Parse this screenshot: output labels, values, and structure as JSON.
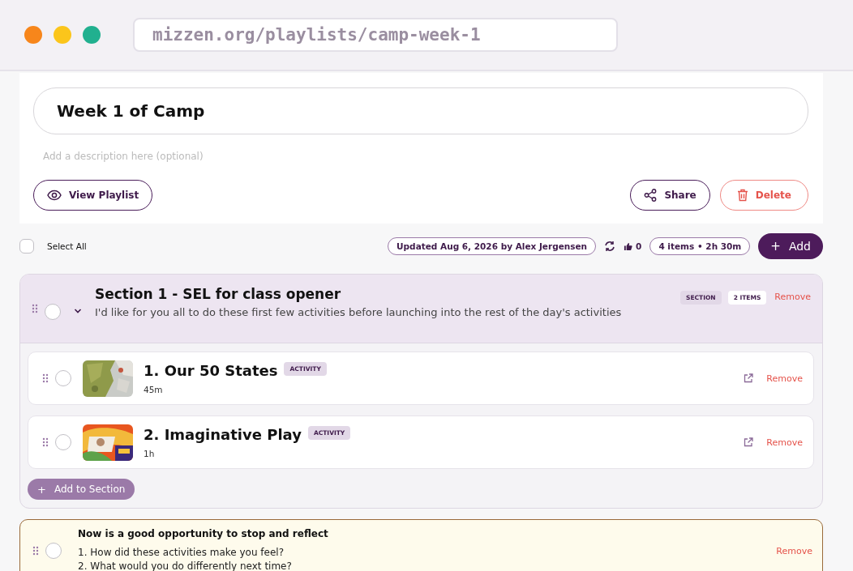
{
  "browser": {
    "url": "mizzen.org/playlists/camp-week-1"
  },
  "playlist": {
    "title": "Week 1 of Camp",
    "description_placeholder": "Add a description here (optional)",
    "view_button": "View Playlist",
    "share_button": "Share",
    "delete_button": "Delete"
  },
  "toolbar": {
    "select_all": {
      "label": "Select All",
      "checked": false
    },
    "updated": "Updated Aug 6, 2026 by Alex Jergensen",
    "likes": "0",
    "summary": "4 items • 2h 30m",
    "add_button": "+",
    "add_label": "Add"
  },
  "sections": [
    {
      "title": "Section 1 - SEL for class opener",
      "description": "I'd like for you all to do these first few activities before launching into the rest of the day's activities",
      "tag": "SECTION",
      "count": "2 ITEMS",
      "remove": "Remove",
      "checked": false,
      "expanded": true,
      "items": [
        {
          "title": "1. Our 50 States",
          "tag": "ACTIVITY",
          "duration": "45m",
          "remove": "Remove",
          "checked": false
        },
        {
          "title": "2. Imaginative Play",
          "tag": "ACTIVITY",
          "duration": "1h",
          "remove": "Remove",
          "checked": false
        }
      ],
      "add_button": "+",
      "add_label": "Add to Section"
    }
  ],
  "note": {
    "title": "Now is a good opportunity to stop and reflect",
    "lines": [
      "1. How did these activities make you feel?",
      "2. What would you do differently next time?"
    ],
    "remove": "Remove",
    "checked": false
  }
}
